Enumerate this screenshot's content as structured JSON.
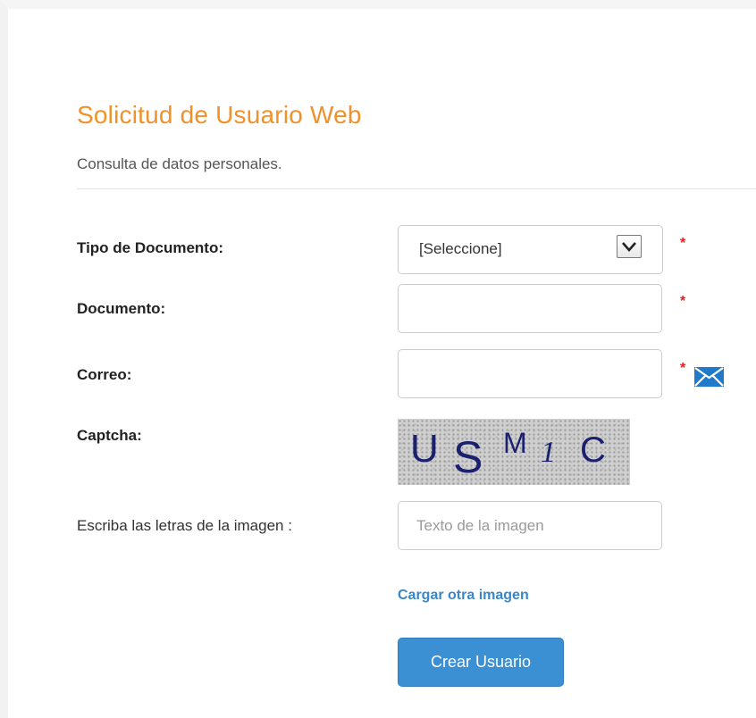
{
  "header": {
    "title": "Solicitud de Usuario Web",
    "subtitle": "Consulta de datos personales."
  },
  "form": {
    "tipo_documento": {
      "label": "Tipo de Documento:",
      "selected": "[Seleccione]",
      "required_mark": "*"
    },
    "documento": {
      "label": "Documento:",
      "value": "",
      "required_mark": "*"
    },
    "correo": {
      "label": "Correo:",
      "value": "",
      "required_mark": "*",
      "icon": "mail-icon"
    },
    "captcha": {
      "label": "Captcha:",
      "image_text": "USM1C"
    },
    "captcha_input": {
      "label": "Escriba las letras de la imagen :",
      "placeholder": "Texto de la imagen",
      "value": ""
    },
    "reload_link": "Cargar otra imagen",
    "submit_label": "Crear Usuario"
  },
  "colors": {
    "title": "#f0922b",
    "required": "#e02020",
    "link": "#3a87c8",
    "primary_button": "#3b8fd3",
    "mail_icon": "#1f7ac9"
  }
}
